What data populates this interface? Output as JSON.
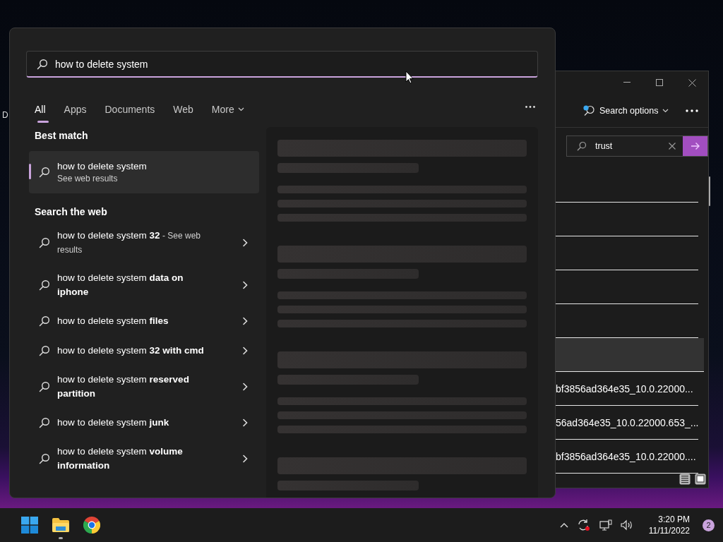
{
  "desktop": {
    "icon_label": "D"
  },
  "search_panel": {
    "query": "how to delete system",
    "tabs": [
      {
        "label": "All",
        "selected": true
      },
      {
        "label": "Apps",
        "selected": false
      },
      {
        "label": "Documents",
        "selected": false
      },
      {
        "label": "Web",
        "selected": false
      },
      {
        "label": "More",
        "selected": false,
        "kind": "dropdown"
      }
    ],
    "best_match": {
      "heading": "Best match",
      "title": "how to delete system",
      "subtitle": "See web results",
      "selected": true
    },
    "web": {
      "heading": "Search the web",
      "items": [
        {
          "text": "how to delete system **32**",
          "suffix": "- See web results"
        },
        {
          "text": "how to delete system **data on iphone**"
        },
        {
          "text": "how to delete system **files**"
        },
        {
          "text": "how to delete system **32 with cmd**"
        },
        {
          "text": "how to delete system **reserved partition**"
        },
        {
          "text": "how to delete system **junk**"
        },
        {
          "text": "how to delete system **volume information**"
        }
      ]
    },
    "preview": {
      "loading": true
    }
  },
  "explorer": {
    "search_options": "Search options",
    "search_query": "trust",
    "rows": [
      {
        "selected": false
      },
      {
        "selected": false
      },
      {
        "selected": false
      },
      {
        "selected": false
      },
      {
        "selected": false
      },
      {
        "selected": true
      },
      {
        "text": "bf3856ad364e35_10.0.22000...",
        "selected": false
      },
      {
        "text": "56ad364e35_10.0.22000.653_...",
        "selected": false
      },
      {
        "text": "bf3856ad364e35_10.0.22000....",
        "selected": false
      }
    ]
  },
  "taskbar": {
    "apps": [
      {
        "kind": "windows",
        "running": false
      },
      {
        "kind": "explorer",
        "running": true
      },
      {
        "kind": "chrome",
        "running": false
      }
    ],
    "time": "3:20 PM",
    "date": "11/11/2022",
    "notifications": "2"
  }
}
